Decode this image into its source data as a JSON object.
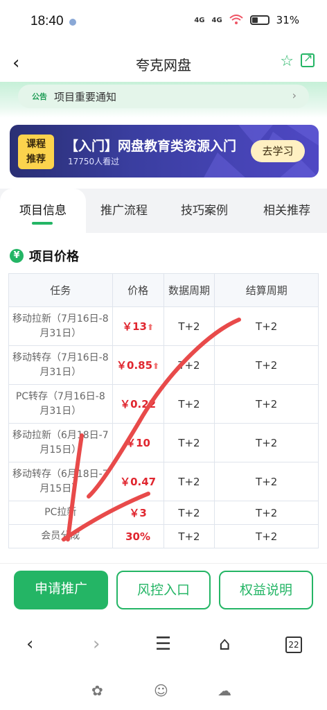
{
  "status_bar": {
    "time": "18:40",
    "signal_a": "4G",
    "signal_b": "4G",
    "battery": "31%"
  },
  "header": {
    "title": "夸克网盘",
    "back_icon": "back-arrow-icon",
    "star_icon": "star-icon",
    "share_icon": "share-icon"
  },
  "notice": {
    "tag": "公告",
    "text": "项目重要通知",
    "arrow": "›"
  },
  "banner": {
    "tag_line1": "课程",
    "tag_line2": "推荐",
    "title": "【入门】网盘教育类资源入门",
    "subtitle": "17750人看过",
    "button": "去学习"
  },
  "tabs": [
    {
      "label": "项目信息",
      "active": true
    },
    {
      "label": "推广流程",
      "active": false
    },
    {
      "label": "技巧案例",
      "active": false
    },
    {
      "label": "相关推荐",
      "active": false
    }
  ],
  "section": {
    "icon": "yen-icon",
    "icon_glyph": "¥",
    "title": "项目价格"
  },
  "table": {
    "headers": [
      "任务",
      "价格",
      "数据周期",
      "结算周期"
    ],
    "rows": [
      {
        "task": "移动拉新（7月16日-8月31日）",
        "price": "￥13",
        "up": true,
        "data_cycle": "T+2",
        "settle_cycle": "T+2"
      },
      {
        "task": "移动转存（7月16日-8月31日）",
        "price": "￥0.85",
        "up": true,
        "data_cycle": "T+2",
        "settle_cycle": "T+2"
      },
      {
        "task": "PC转存（7月16日-8月31日）",
        "price": "￥0.22",
        "up": false,
        "data_cycle": "T+2",
        "settle_cycle": "T+2"
      },
      {
        "task": "移动拉新（6月18日-7月15日）",
        "price": "￥10",
        "up": false,
        "data_cycle": "T+2",
        "settle_cycle": "T+2"
      },
      {
        "task": "移动转存（6月18日-7月15日）",
        "price": "￥0.47",
        "up": false,
        "data_cycle": "T+2",
        "settle_cycle": "T+2"
      },
      {
        "task": "PC拉新",
        "price": "￥3",
        "up": false,
        "data_cycle": "T+2",
        "settle_cycle": "T+2"
      },
      {
        "task": "会员分成",
        "price": "30%",
        "up": false,
        "data_cycle": "T+2",
        "settle_cycle": "T+2"
      }
    ],
    "up_arrow": "⬆"
  },
  "actions": {
    "apply": "申请推广",
    "risk": "风控入口",
    "rights": "权益说明"
  },
  "browser_bar": {
    "back": "‹",
    "forward": "›",
    "menu": "☰",
    "home": "⌂",
    "tab_count": "22"
  },
  "colors": {
    "brand_green": "#24b565",
    "price_red": "#e0262f",
    "banner_blue": "#3a3ea0",
    "scribble_red": "#e84a4a"
  }
}
